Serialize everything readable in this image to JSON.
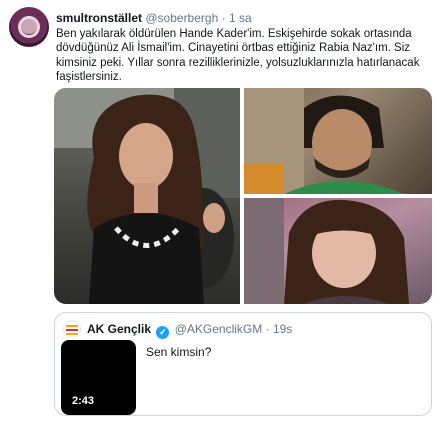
{
  "tweet": {
    "display_name": "smultronstället",
    "handle": "@soberbergh",
    "separator": "·",
    "time": "1 sa",
    "text": "Ben yakılarak öldürülen Hande Kader'im. Eskişehirde sokak ortasında dövdüğünüz Ali İsmail'im. Cinayetini örtbas ettiğiniz Rabia Naz'ım. Siz kimsiniz peki. Yıllar sonra rezilliklerinizle, yolsuzluklarınızla hatırlanacak faşistlersiniz."
  },
  "quoted": {
    "display_name": "AK Gençlik",
    "verified_mark": "✓",
    "handle": "@AKGenclikGM",
    "separator": "·",
    "time": "19s",
    "text": "Sen kimsin?",
    "video_duration": "2:43"
  }
}
